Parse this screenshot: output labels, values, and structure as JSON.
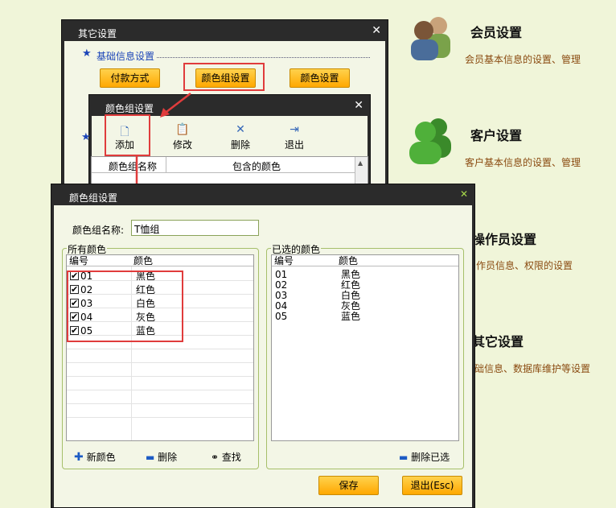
{
  "right_panel": {
    "member": {
      "title": "会员设置",
      "sub": "会员基本信息的设置、管理"
    },
    "customer": {
      "title": "客户设置",
      "sub": "客户基本信息的设置、管理"
    },
    "operator": {
      "title": "操作员设置",
      "sub": "作员信息、权限的设置"
    },
    "other": {
      "title": "其它设置",
      "sub": "础信息、数据库维护等设置"
    }
  },
  "win_other": {
    "title": "其它设置",
    "section": "基础信息设置",
    "buttons": [
      "付款方式",
      "颜色组设置",
      "颜色设置"
    ]
  },
  "win_colorgroup_list": {
    "title": "颜色组设置",
    "toolbar": [
      "添加",
      "修改",
      "删除",
      "退出"
    ],
    "columns": [
      "颜色组名称",
      "包含的颜色"
    ]
  },
  "win_colorgroup_edit": {
    "title": "颜色组设置",
    "name_label": "颜色组名称:",
    "name_value": "T恤组",
    "all_colors": {
      "label": "所有颜色",
      "columns": [
        "编号",
        "颜色"
      ],
      "rows": [
        {
          "id": "01",
          "name": "黑色"
        },
        {
          "id": "02",
          "name": "红色"
        },
        {
          "id": "03",
          "name": "白色"
        },
        {
          "id": "04",
          "name": "灰色"
        },
        {
          "id": "05",
          "name": "蓝色"
        }
      ],
      "actions": [
        "新颜色",
        "删除",
        "查找"
      ]
    },
    "selected_colors": {
      "label": "已选的颜色",
      "columns": [
        "编号",
        "颜色"
      ],
      "rows": [
        {
          "id": "01",
          "name": "黑色"
        },
        {
          "id": "02",
          "name": "红色"
        },
        {
          "id": "03",
          "name": "白色"
        },
        {
          "id": "04",
          "name": "灰色"
        },
        {
          "id": "05",
          "name": "蓝色"
        }
      ],
      "action": "删除已选"
    },
    "save": "保存",
    "exit": "退出(Esc)"
  }
}
